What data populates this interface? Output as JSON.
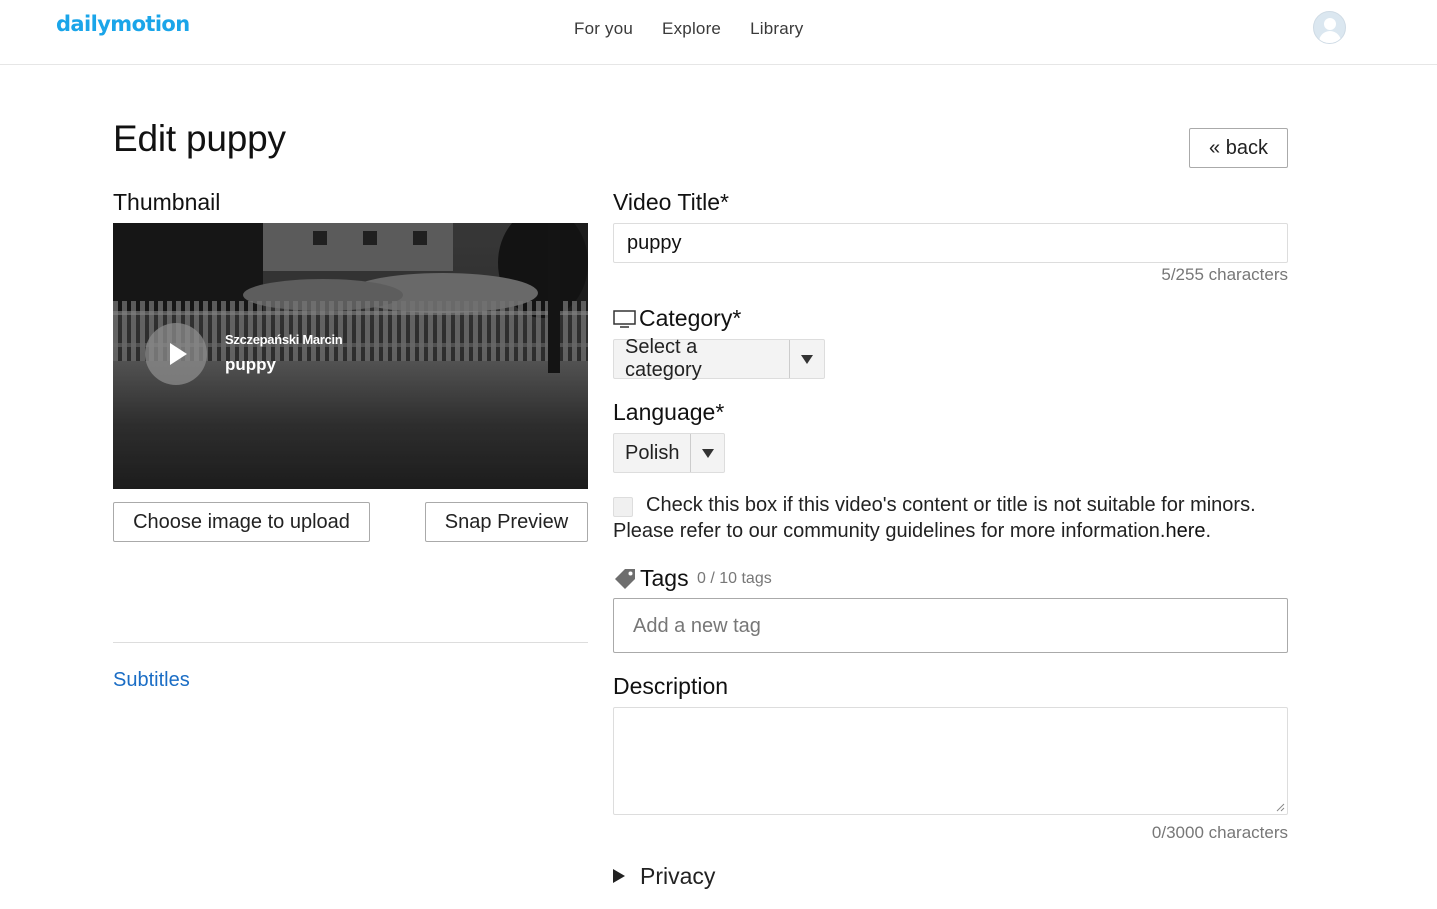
{
  "header": {
    "logo": "dailymotion",
    "nav": [
      "For you",
      "Explore",
      "Library"
    ]
  },
  "page": {
    "title": "Edit puppy",
    "back_label": "« back"
  },
  "thumbnail": {
    "label": "Thumbnail",
    "author": "Szczepański Marcin",
    "video_title": "puppy",
    "upload_button": "Choose image to upload",
    "snap_button": "Snap Preview"
  },
  "subtitles_link": "Subtitles",
  "form": {
    "title_label": "Video Title*",
    "title_value": "puppy",
    "title_counter": "5/255 characters",
    "category_label": "Category*",
    "category_value": "Select a category",
    "language_label": "Language*",
    "language_value": "Polish",
    "minors_text": "Check this box if this video's content or title is not suitable for minors.",
    "guidelines_text": "Please refer to our community guidelines for more information.",
    "guidelines_link": "here",
    "guidelines_end": ".",
    "minors_checked": false,
    "tags_label": "Tags",
    "tags_count": "0 / 10 tags",
    "tag_placeholder": "Add a new tag",
    "description_label": "Description",
    "description_value": "",
    "description_counter": "0/3000 characters",
    "privacy_label": "Privacy"
  },
  "colors": {
    "brand": "#1aa5e9",
    "link": "#1a6dc5"
  },
  "icons": [
    "play-icon",
    "tv-icon",
    "tag-icon",
    "chevron-down-icon",
    "triangle-right-icon",
    "avatar-icon"
  ]
}
